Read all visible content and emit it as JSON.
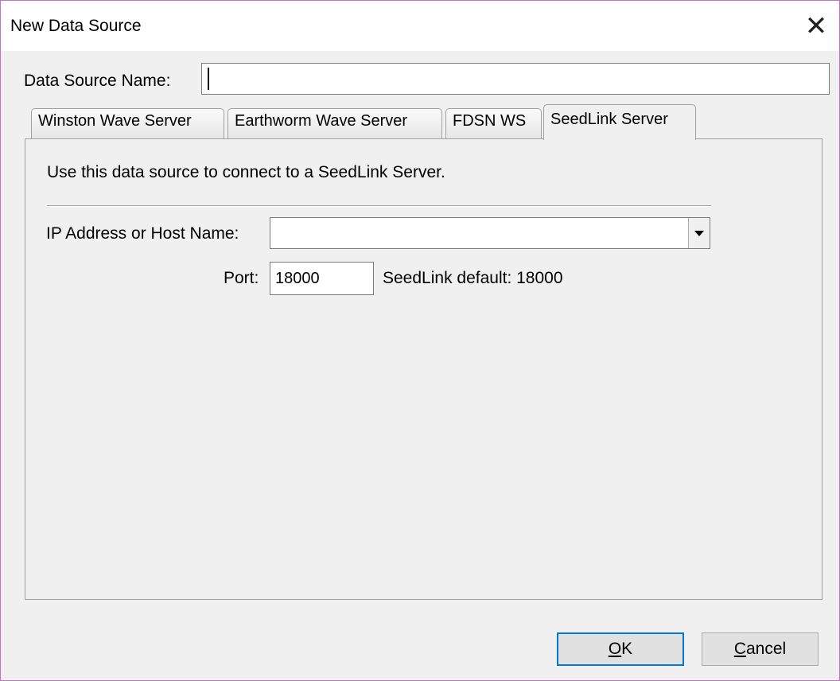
{
  "window": {
    "title": "New Data Source",
    "close_glyph": "✕"
  },
  "form": {
    "name_label": "Data Source Name:",
    "name_value": ""
  },
  "tabs": [
    {
      "label": "Winston Wave Server",
      "active": false
    },
    {
      "label": "Earthworm Wave Server",
      "active": false
    },
    {
      "label": "FDSN WS",
      "active": false
    },
    {
      "label": "SeedLink Server",
      "active": true
    }
  ],
  "seedlink": {
    "description": "Use this data source to connect to a SeedLink Server.",
    "host_label": "IP Address or Host Name:",
    "host_value": "",
    "port_label": "Port:",
    "port_value": "18000",
    "port_hint": "SeedLink default: 18000"
  },
  "buttons": {
    "ok_mnemonic": "O",
    "ok_rest": "K",
    "cancel_mnemonic": "C",
    "cancel_rest": "ancel"
  },
  "colors": {
    "window_border": "#c86fc6",
    "default_button_border": "#0078d7"
  }
}
